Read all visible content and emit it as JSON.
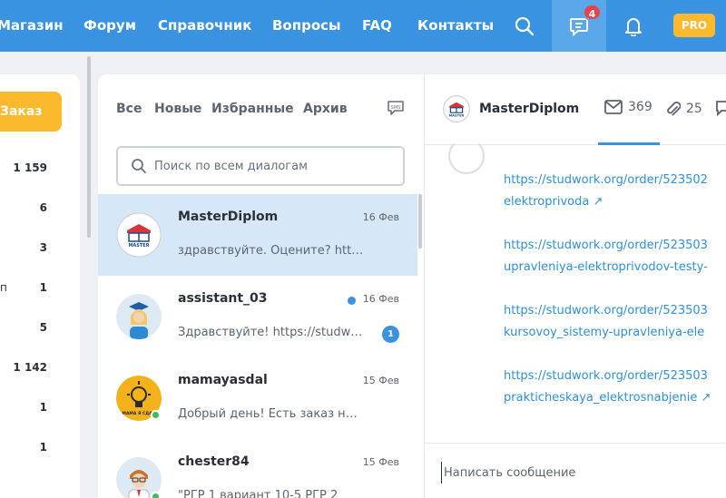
{
  "nav": {
    "items": [
      "Магазин",
      "Форум",
      "Справочник",
      "Вопросы",
      "FAQ",
      "Контакты"
    ],
    "messages_count": "4",
    "pro_label": "PRO"
  },
  "sidebar": {
    "order_button_label": "Заказ",
    "counts": [
      "1 159",
      "6",
      "3",
      "1",
      "5",
      "1 142",
      "1",
      "1"
    ]
  },
  "dialogs_panel": {
    "filters": [
      "Все",
      "Новые",
      "Избранные",
      "Архив"
    ],
    "search_placeholder": "Поиск по всем диалогам",
    "dialogs": [
      {
        "name": "MasterDiplom",
        "date": "16 Фев",
        "preview": "здравствуйте. Оцените? https://studwork.org"
      },
      {
        "name": "assistant_03",
        "date": "16 Фев",
        "preview": "Здравствуйте! https://studwork.org",
        "unread": "1"
      },
      {
        "name": "mamayasdal",
        "date": "15 Фев",
        "preview": "Добрый день! Есть заказ на выполнение"
      },
      {
        "name": "chester84",
        "date": "15 Фев",
        "preview": "\"РГР 1 вариант 10-5 РГР 2"
      }
    ]
  },
  "chat": {
    "contact_name": "MasterDiplom",
    "mail_count": "369",
    "attach_count": "25",
    "messages": [
      {
        "line1": "https://studwork.org/order/523502",
        "line2": "elektroprivoda"
      },
      {
        "line1": "https://studwork.org/order/523503",
        "line2": "upravleniya-elektroprivodov-testy-"
      },
      {
        "line1": "https://studwork.org/order/523503",
        "line2": "kursovoy_sistemy-upravleniya-ele"
      },
      {
        "line1": "https://studwork.org/order/523503",
        "line2": "prakticheskaya_elektrosnabjenie"
      }
    ],
    "composer_placeholder": "Написать сообщение"
  },
  "colors": {
    "nav_bg": "#3a93e0",
    "accent_orange": "#fbb92d",
    "link_blue": "#2f8fd8",
    "active_dialog_bg": "#d6e8f7",
    "badge_red": "#e8434b"
  }
}
